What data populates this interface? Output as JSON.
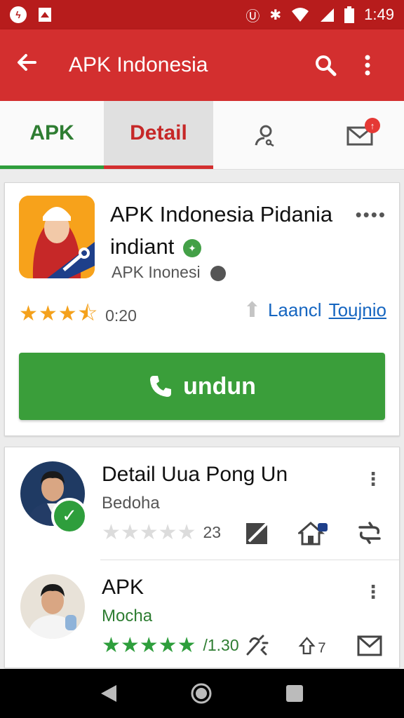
{
  "status_bar": {
    "time": "1:49",
    "left_icons": [
      "app-notification-icon",
      "pdf-notification-icon"
    ],
    "right_icons": [
      "vpn-icon",
      "bluetooth-icon",
      "wifi-icon",
      "signal-icon",
      "battery-icon"
    ]
  },
  "app_bar": {
    "title": "APK Indonesia",
    "back_icon": "arrow-back-icon",
    "actions": [
      "search-icon",
      "overflow-menu-icon"
    ],
    "color": "#d32f2f"
  },
  "tabs": [
    {
      "label": "APK",
      "color": "#2e7d32"
    },
    {
      "label": "Detail",
      "color": "#c62828",
      "selected": true
    },
    {
      "label": "",
      "icon": "user-search-icon"
    },
    {
      "label": "",
      "icon": "mail-icon",
      "badge": "↑"
    }
  ],
  "app_card": {
    "name": "APK Indonesia Pidania indiant",
    "publisher": "APK Inonesi",
    "rating": 3.5,
    "rating_text": "0:20",
    "launch_label": "Laancl",
    "launch_link": "Toujnio",
    "install_label": "undun",
    "install_color": "#3a9e3a"
  },
  "list": [
    {
      "title": "Detail Uua Pong Un",
      "subtitle": "Bedoha",
      "rating": 0,
      "count": "23",
      "verified": true,
      "icons": [
        "edit-icon",
        "home-icon",
        "share-icon"
      ]
    },
    {
      "title": "APK",
      "subtitle": "Mocha",
      "rating": 5,
      "count": "/1.30",
      "extra": "7",
      "icons": [
        "magic-icon",
        "upload-icon",
        "mail-icon"
      ]
    }
  ],
  "nav_bar": [
    "back-nav-icon",
    "home-nav-icon",
    "recents-nav-icon"
  ]
}
